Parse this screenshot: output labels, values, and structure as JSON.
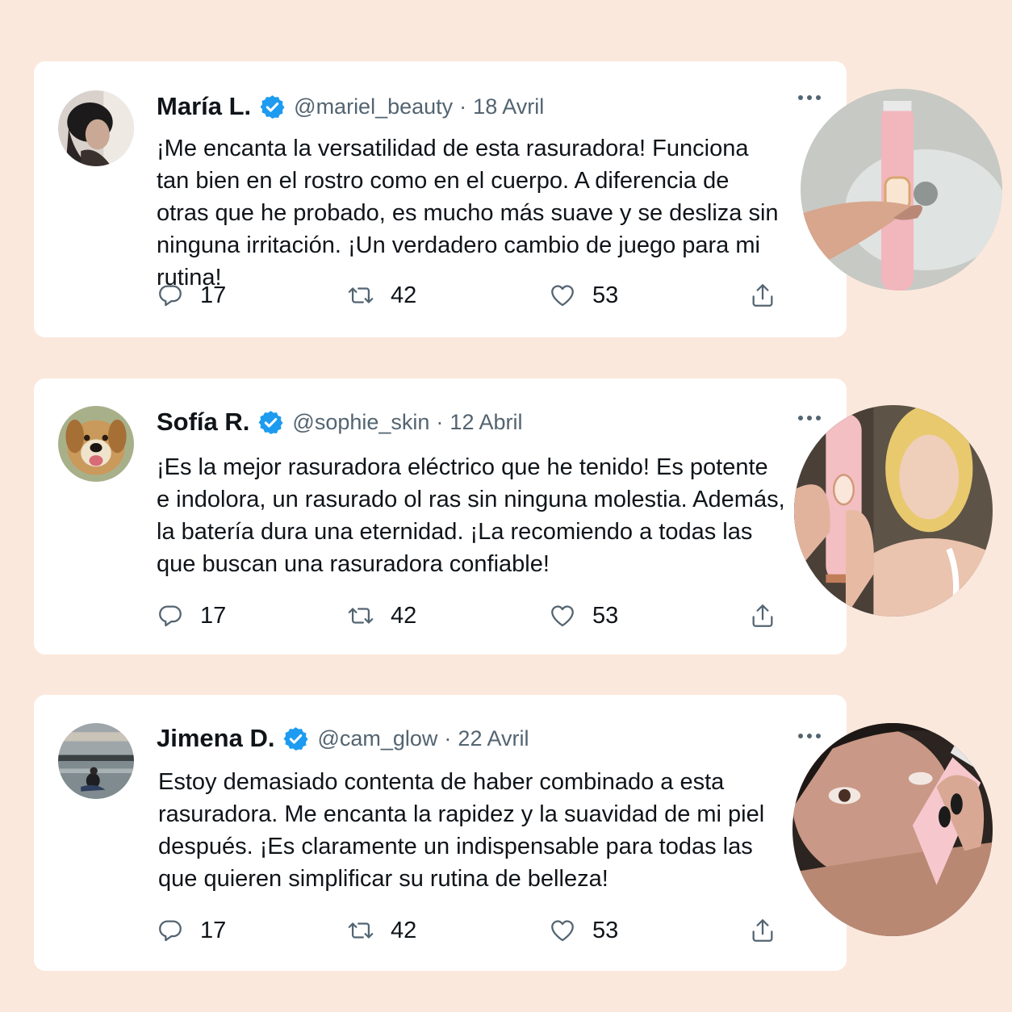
{
  "colors": {
    "background": "#fbe8dc",
    "card": "#ffffff",
    "verified": "#1d9bf0",
    "text": "#0f1419",
    "muted": "#536471"
  },
  "tweets": [
    {
      "name": "María L.",
      "handle": "@mariel_beauty",
      "separator": "·",
      "date": "18 Avril",
      "text": "¡Me encanta la versatilidad de esta rasuradora! Funciona tan bien en el rostro como en el cuerpo. A diferencia de otras que he probado, es mucho más suave y se desliza sin ninguna irritación. ¡Un verdadero cambio de juego para mi rutina!",
      "replies": "17",
      "retweets": "42",
      "likes": "53",
      "avatar_icon": "woman-portrait",
      "photo_icon": "pink-shaver-in-hand"
    },
    {
      "name": "Sofía R.",
      "handle": "@sophie_skin",
      "separator": "·",
      "date": "12 Abril",
      "text": "¡Es la mejor rasuradora eléctrico que he tenido! Es potente e indolora, un rasurado ol ras sin ninguna molestia. Además, la batería dura una eternidad. ¡La recomiendo a todas las que buscan una rasuradora confiable!",
      "replies": "17",
      "retweets": "42",
      "likes": "53",
      "avatar_icon": "dog-portrait",
      "photo_icon": "woman-holding-shaver"
    },
    {
      "name": "Jimena D.",
      "handle": "@cam_glow",
      "separator": "·",
      "date": "22 Avril",
      "text": "Estoy demasiado contenta de haber combinado a esta rasuradora. Me encanta la rapidez y la suavidad de mi piel después. ¡Es claramente un indispensable para todas las que quieren simplificar su rutina de belleza!",
      "replies": "17",
      "retweets": "42",
      "likes": "53",
      "avatar_icon": "lake-sunset-portrait",
      "photo_icon": "woman-shaving-arm"
    }
  ]
}
